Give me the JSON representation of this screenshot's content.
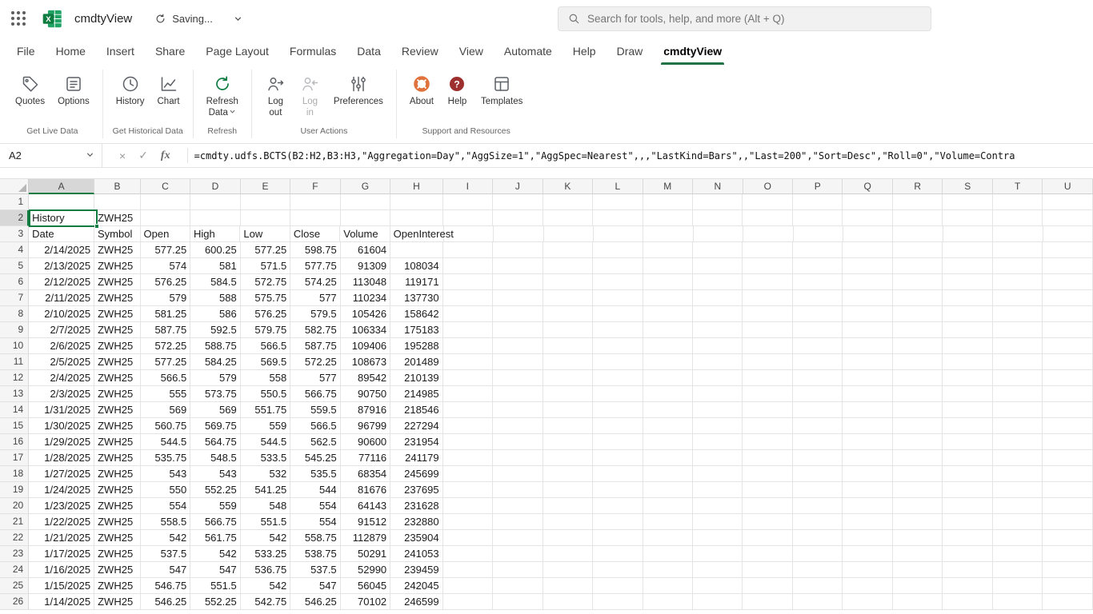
{
  "colors": {
    "excel_green": "#107c41",
    "tab_underline": "#217346",
    "selection_green": "#107c41",
    "about_ring_orange": "#e0733d",
    "help_badge_red": "#9e2f2f"
  },
  "titlebar": {
    "file_name": "cmdtyView",
    "saving_status": "Saving...",
    "search_placeholder": "Search for tools, help, and more (Alt + Q)"
  },
  "ribbon_tabs": [
    {
      "label": "File",
      "active": false
    },
    {
      "label": "Home",
      "active": false
    },
    {
      "label": "Insert",
      "active": false
    },
    {
      "label": "Share",
      "active": false
    },
    {
      "label": "Page Layout",
      "active": false
    },
    {
      "label": "Formulas",
      "active": false
    },
    {
      "label": "Data",
      "active": false
    },
    {
      "label": "Review",
      "active": false
    },
    {
      "label": "View",
      "active": false
    },
    {
      "label": "Automate",
      "active": false
    },
    {
      "label": "Help",
      "active": false
    },
    {
      "label": "Draw",
      "active": false
    },
    {
      "label": "cmdtyView",
      "active": true
    }
  ],
  "ribbon": {
    "groups": [
      {
        "label": "Get Live Data",
        "buttons": [
          {
            "label": "Quotes",
            "icon": "quotes-icon"
          },
          {
            "label": "Options",
            "icon": "options-icon"
          }
        ]
      },
      {
        "label": "Get Historical Data",
        "buttons": [
          {
            "label": "History",
            "icon": "history-icon"
          },
          {
            "label": "Chart",
            "icon": "chart-icon"
          }
        ]
      },
      {
        "label": "Refresh",
        "buttons": [
          {
            "label": "Refresh Data",
            "icon": "refresh-icon",
            "dropdown": true,
            "two_line": true
          }
        ]
      },
      {
        "label": "User Actions",
        "buttons": [
          {
            "label": "Log out",
            "icon": "logout-icon",
            "two_line": true
          },
          {
            "label": "Log in",
            "icon": "login-icon",
            "two_line": true,
            "disabled": true
          },
          {
            "label": "Preferences",
            "icon": "preferences-icon"
          }
        ]
      },
      {
        "label": "Support and Resources",
        "buttons": [
          {
            "label": "About",
            "icon": "about-icon"
          },
          {
            "label": "Help",
            "icon": "help-icon"
          },
          {
            "label": "Templates",
            "icon": "templates-icon"
          }
        ]
      }
    ]
  },
  "formula_bar": {
    "name_box": "A2",
    "cancel_glyph": "×",
    "enter_glyph": "✓",
    "fx_glyph": "fx",
    "formula": "=cmdty.udfs.BCTS(B2:H2,B3:H3,\"Aggregation=Day\",\"AggSize=1\",\"AggSpec=Nearest\",,,\"LastKind=Bars\",,\"Last=200\",\"Sort=Desc\",\"Roll=0\",\"Volume=Contra"
  },
  "grid": {
    "columns": [
      "A",
      "B",
      "C",
      "D",
      "E",
      "F",
      "G",
      "H",
      "I",
      "J",
      "K",
      "L",
      "M",
      "N",
      "O",
      "P",
      "Q",
      "R",
      "S",
      "T",
      "U"
    ],
    "selected_cell": "A2",
    "selected_column": "A",
    "selected_row": 2,
    "rows": [
      {
        "n": 1,
        "cells": []
      },
      {
        "n": 2,
        "cells": [
          "History",
          "ZWH25"
        ]
      },
      {
        "n": 3,
        "cells": [
          "Date",
          "Symbol",
          "Open",
          "High",
          "Low",
          "Close",
          "Volume",
          "OpenInterest"
        ]
      },
      {
        "n": 4,
        "cells": [
          "2/14/2025",
          "ZWH25",
          "577.25",
          "600.25",
          "577.25",
          "598.75",
          "61604",
          ""
        ]
      },
      {
        "n": 5,
        "cells": [
          "2/13/2025",
          "ZWH25",
          "574",
          "581",
          "571.5",
          "577.75",
          "91309",
          "108034"
        ]
      },
      {
        "n": 6,
        "cells": [
          "2/12/2025",
          "ZWH25",
          "576.25",
          "584.5",
          "572.75",
          "574.25",
          "113048",
          "119171"
        ]
      },
      {
        "n": 7,
        "cells": [
          "2/11/2025",
          "ZWH25",
          "579",
          "588",
          "575.75",
          "577",
          "110234",
          "137730"
        ]
      },
      {
        "n": 8,
        "cells": [
          "2/10/2025",
          "ZWH25",
          "581.25",
          "586",
          "576.25",
          "579.5",
          "105426",
          "158642"
        ]
      },
      {
        "n": 9,
        "cells": [
          "2/7/2025",
          "ZWH25",
          "587.75",
          "592.5",
          "579.75",
          "582.75",
          "106334",
          "175183"
        ]
      },
      {
        "n": 10,
        "cells": [
          "2/6/2025",
          "ZWH25",
          "572.25",
          "588.75",
          "566.5",
          "587.75",
          "109406",
          "195288"
        ]
      },
      {
        "n": 11,
        "cells": [
          "2/5/2025",
          "ZWH25",
          "577.25",
          "584.25",
          "569.5",
          "572.25",
          "108673",
          "201489"
        ]
      },
      {
        "n": 12,
        "cells": [
          "2/4/2025",
          "ZWH25",
          "566.5",
          "579",
          "558",
          "577",
          "89542",
          "210139"
        ]
      },
      {
        "n": 13,
        "cells": [
          "2/3/2025",
          "ZWH25",
          "555",
          "573.75",
          "550.5",
          "566.75",
          "90750",
          "214985"
        ]
      },
      {
        "n": 14,
        "cells": [
          "1/31/2025",
          "ZWH25",
          "569",
          "569",
          "551.75",
          "559.5",
          "87916",
          "218546"
        ]
      },
      {
        "n": 15,
        "cells": [
          "1/30/2025",
          "ZWH25",
          "560.75",
          "569.75",
          "559",
          "566.5",
          "96799",
          "227294"
        ]
      },
      {
        "n": 16,
        "cells": [
          "1/29/2025",
          "ZWH25",
          "544.5",
          "564.75",
          "544.5",
          "562.5",
          "90600",
          "231954"
        ]
      },
      {
        "n": 17,
        "cells": [
          "1/28/2025",
          "ZWH25",
          "535.75",
          "548.5",
          "533.5",
          "545.25",
          "77116",
          "241179"
        ]
      },
      {
        "n": 18,
        "cells": [
          "1/27/2025",
          "ZWH25",
          "543",
          "543",
          "532",
          "535.5",
          "68354",
          "245699"
        ]
      },
      {
        "n": 19,
        "cells": [
          "1/24/2025",
          "ZWH25",
          "550",
          "552.25",
          "541.25",
          "544",
          "81676",
          "237695"
        ]
      },
      {
        "n": 20,
        "cells": [
          "1/23/2025",
          "ZWH25",
          "554",
          "559",
          "548",
          "554",
          "64143",
          "231628"
        ]
      },
      {
        "n": 21,
        "cells": [
          "1/22/2025",
          "ZWH25",
          "558.5",
          "566.75",
          "551.5",
          "554",
          "91512",
          "232880"
        ]
      },
      {
        "n": 22,
        "cells": [
          "1/21/2025",
          "ZWH25",
          "542",
          "561.75",
          "542",
          "558.75",
          "112879",
          "235904"
        ]
      },
      {
        "n": 23,
        "cells": [
          "1/17/2025",
          "ZWH25",
          "537.5",
          "542",
          "533.25",
          "538.75",
          "50291",
          "241053"
        ]
      },
      {
        "n": 24,
        "cells": [
          "1/16/2025",
          "ZWH25",
          "547",
          "547",
          "536.75",
          "537.5",
          "52990",
          "239459"
        ]
      },
      {
        "n": 25,
        "cells": [
          "1/15/2025",
          "ZWH25",
          "546.75",
          "551.5",
          "542",
          "547",
          "56045",
          "242045"
        ]
      },
      {
        "n": 26,
        "cells": [
          "1/14/2025",
          "ZWH25",
          "546.25",
          "552.25",
          "542.75",
          "546.25",
          "70102",
          "246599"
        ]
      }
    ]
  }
}
